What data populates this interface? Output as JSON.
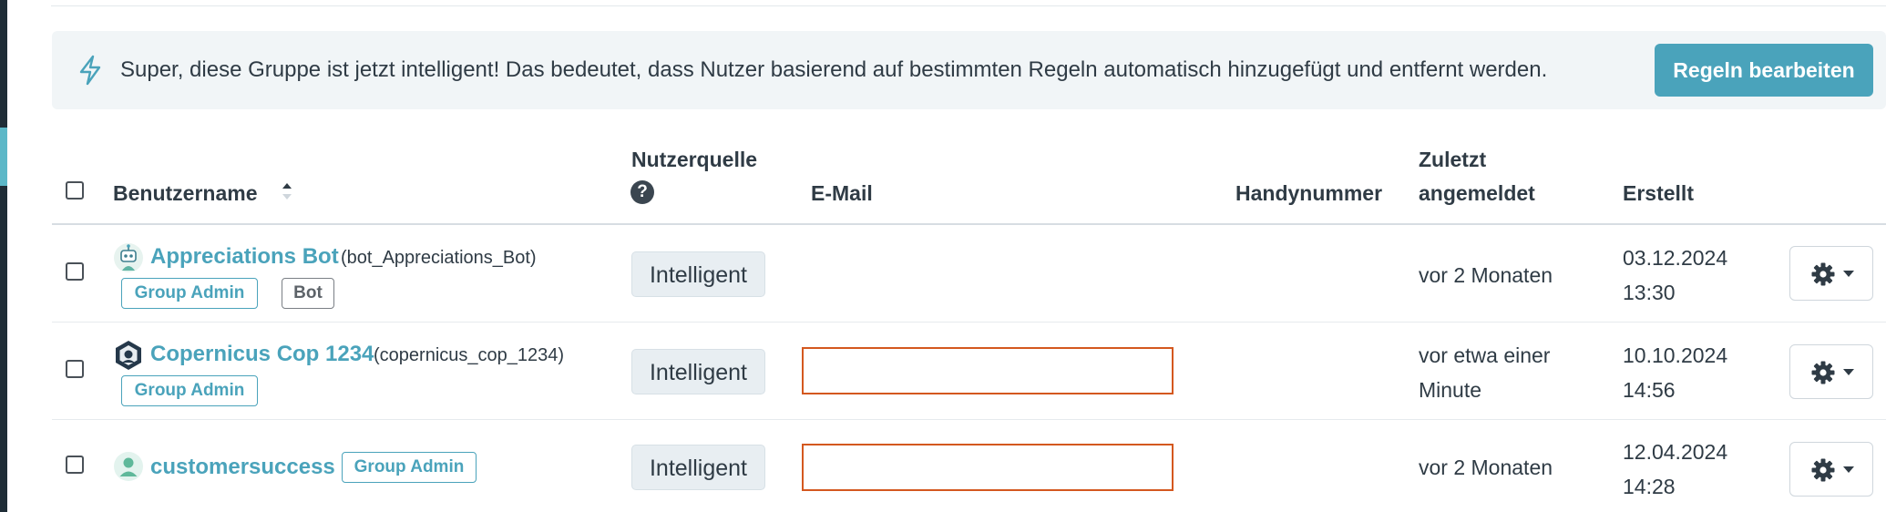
{
  "banner": {
    "text": "Super, diese Gruppe ist jetzt intelligent! Das bedeutet, dass Nutzer basierend auf bestimmten Regeln automatisch hinzugefügt und entfernt werden.",
    "edit_rules_label": "Regeln bearbeiten",
    "icon": "bolt-icon"
  },
  "table": {
    "headers": {
      "username": "Benutzername",
      "source_line1": "Nutzerquelle",
      "email": "E-Mail",
      "phone": "Handynummer",
      "last_login_line1": "Zuletzt",
      "last_login_line2": "angemeldet",
      "created": "Erstellt"
    },
    "help_glyph": "?",
    "rows": [
      {
        "name": "Appreciations Bot",
        "handle": "(bot_Appreciations_Bot)",
        "badges": [
          "Group Admin",
          "Bot"
        ],
        "source": "Intelligent",
        "email": "",
        "last_login_line1": "vor 2 Monaten",
        "last_login_line2": "",
        "created_date": "03.12.2024",
        "created_time": "13:30"
      },
      {
        "name": "Copernicus Cop 1234",
        "handle": "(copernicus_cop_1234)",
        "badges": [
          "Group Admin"
        ],
        "source": "Intelligent",
        "email": "",
        "last_login_line1": "vor etwa einer",
        "last_login_line2": "Minute",
        "created_date": "10.10.2024",
        "created_time": "14:56"
      },
      {
        "name": "customersuccess",
        "handle": "",
        "badges": [
          "Group Admin"
        ],
        "source": "Intelligent",
        "email": "",
        "last_login_line1": "vor 2 Monaten",
        "last_login_line2": "",
        "created_date": "12.04.2024",
        "created_time": "14:28"
      }
    ]
  },
  "colors": {
    "accent": "#4aa3bb",
    "banner_bg": "#f1f5f7",
    "email_highlight": "#d4581f"
  }
}
